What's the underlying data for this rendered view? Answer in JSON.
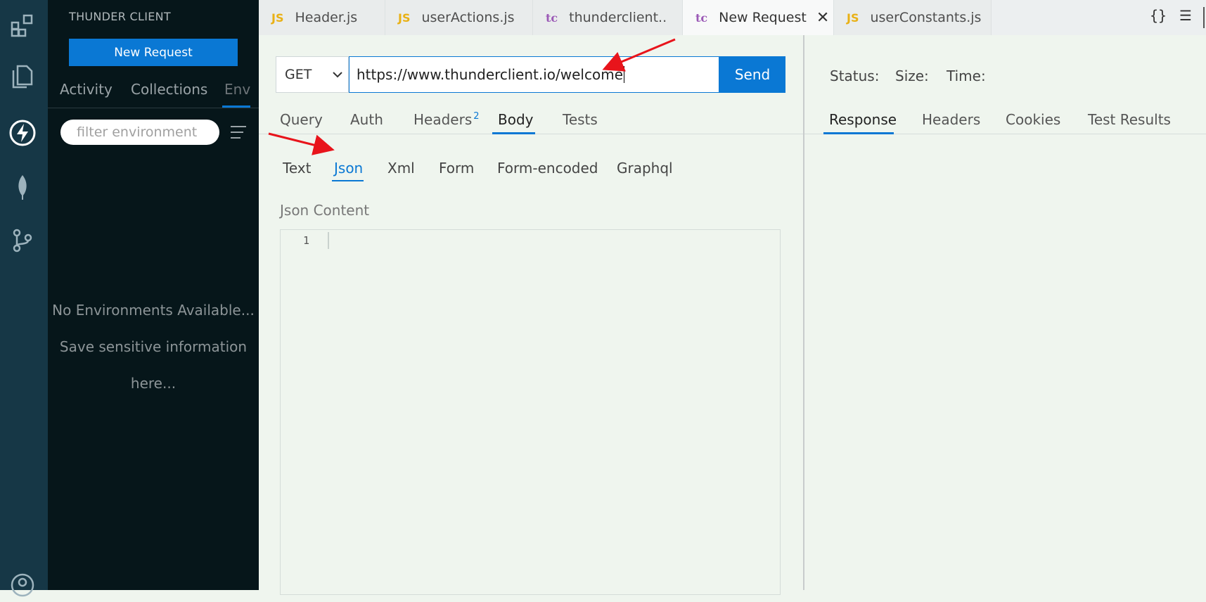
{
  "sidebar": {
    "title": "THUNDER CLIENT",
    "new_request": "New Request",
    "tabs": [
      "Activity",
      "Collections",
      "Env"
    ],
    "filter_placeholder": "filter environment",
    "empty_line1": "No Environments Available...",
    "empty_line2": "Save sensitive information",
    "empty_line3": "here..."
  },
  "tabs": [
    {
      "badge": "JS",
      "label": "Header.js"
    },
    {
      "badge": "JS",
      "label": "userActions.js"
    },
    {
      "badge": "tc",
      "label": "thunderclient.."
    },
    {
      "badge": "tc",
      "label": "New Request",
      "close": "✕"
    },
    {
      "badge": "JS",
      "label": "userConstants.js"
    }
  ],
  "toolbar_icons": {
    "braces": "{}",
    "list": "☰"
  },
  "request": {
    "method": "GET",
    "url": "https://www.thunderclient.io/welcome",
    "send": "Send",
    "tabs": [
      "Query",
      "Auth",
      "Headers",
      "Body",
      "Tests"
    ],
    "headers_count": "2",
    "active_tab": "Body",
    "body_tabs": [
      "Text",
      "Json",
      "Xml",
      "Form",
      "Form-encoded",
      "Graphql"
    ],
    "active_body_tab": "Json",
    "content_label": "Json Content",
    "line_number": "1"
  },
  "response": {
    "status": "Status:",
    "size": "Size:",
    "time": "Time:",
    "tabs": [
      "Response",
      "Headers",
      "Cookies",
      "Test Results"
    ],
    "active_tab": "Response"
  },
  "colors": {
    "accent": "#0a78d4",
    "annotation_arrow": "#e8141b"
  }
}
